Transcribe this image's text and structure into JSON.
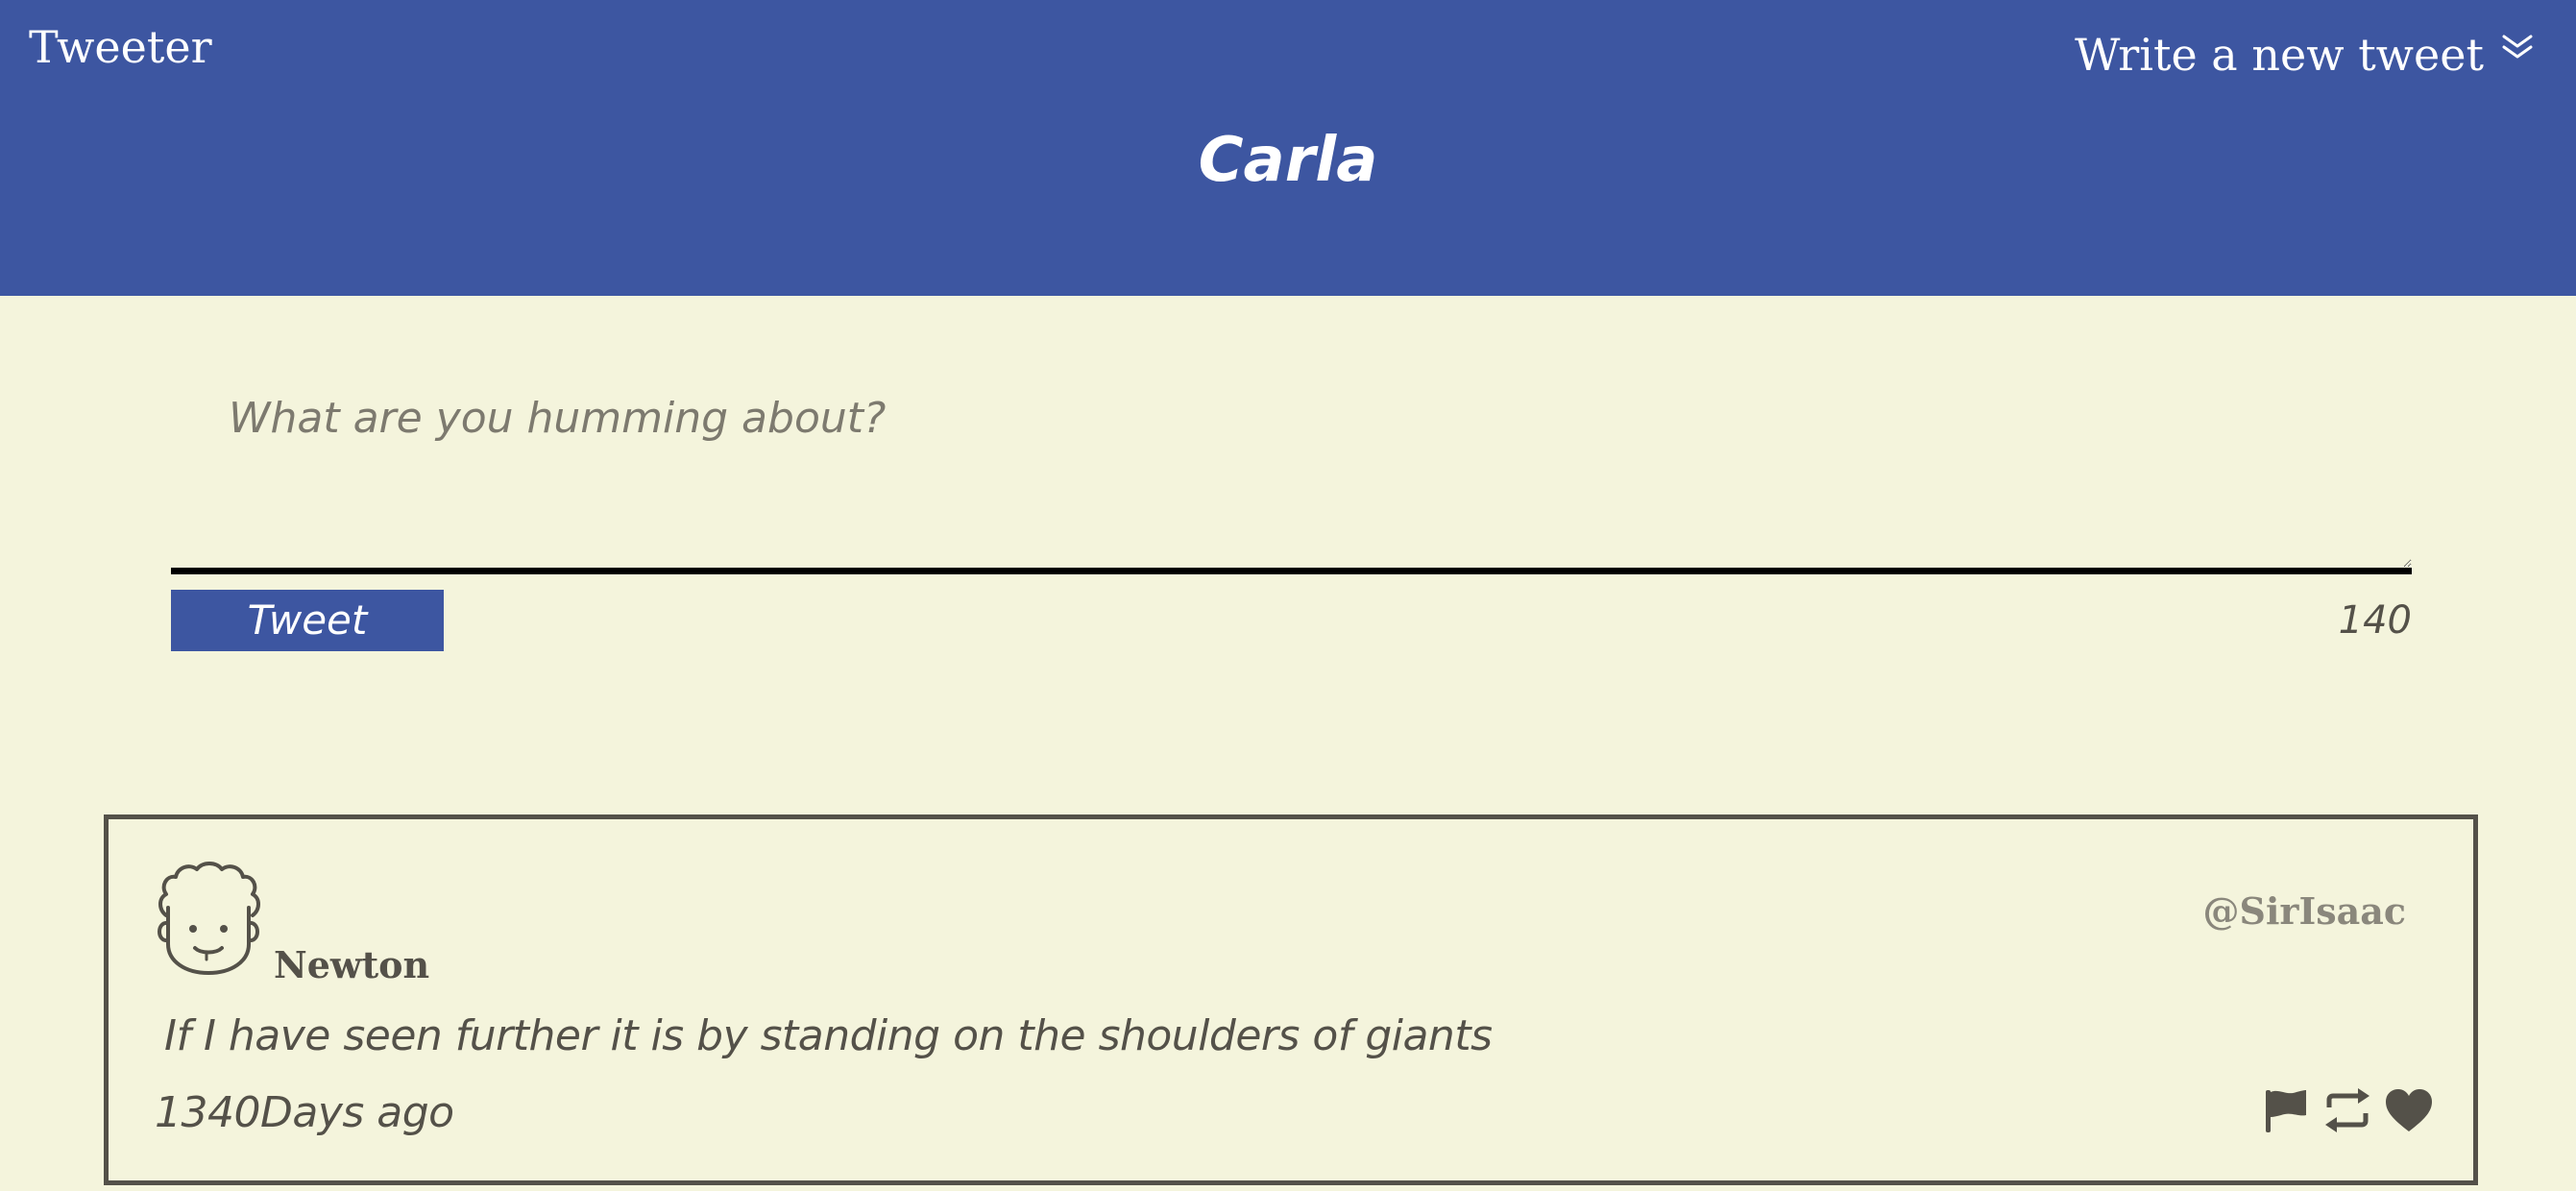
{
  "header": {
    "brand": "Tweeter",
    "compose_toggle_label": "Write a new tweet",
    "compose_toggle_icon": "chevron-double-down-icon",
    "profile_name": "Carla",
    "background_color": "#3d56a1"
  },
  "compose": {
    "placeholder": "What are you humming about?",
    "value": "",
    "submit_label": "Tweet",
    "char_counter": "140"
  },
  "tweets": [
    {
      "avatar_icon": "curly-hair-face-avatar",
      "name": "Newton",
      "handle": "@SirIsaac",
      "text": "If I have seen further it is by standing on the shoulders of giants",
      "time": "1340Days ago",
      "actions": {
        "flag_icon": "flag-icon",
        "retweet_icon": "retweet-icon",
        "like_icon": "heart-icon"
      }
    }
  ],
  "colors": {
    "page_background": "#f4f4dc",
    "accent": "#3d56a1",
    "text": "#545149"
  }
}
